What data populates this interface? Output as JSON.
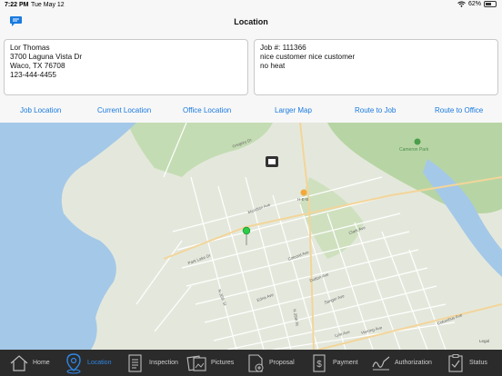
{
  "status": {
    "time": "7:22 PM",
    "date": "Tue May 12",
    "battery_text": "62%",
    "battery_level": 0.62
  },
  "nav": {
    "title": "Location"
  },
  "customer": {
    "lines": [
      "Lor Thomas",
      "3700 Laguna Vista Dr",
      "Waco, TX  76708",
      "123-444-4455"
    ]
  },
  "job": {
    "lines": [
      "Job #: 111366",
      "nice customer nice customer",
      "no heat"
    ]
  },
  "actions": [
    "Job Location",
    "Current Location",
    "Office Location",
    "Larger Map",
    "Route to Job",
    "Route to Office"
  ],
  "map": {
    "labels": {
      "park_lake": "Park Lake Dr",
      "cameron_park": "Cameron Park",
      "heb": "H-E-B",
      "legal": "Legal",
      "meridian": "Meridian Ave",
      "gregory": "Gregory Dr",
      "n_36th": "N 36th St",
      "n_29th": "N 29th St",
      "lyle": "Lyle Ave",
      "herring": "Herring Ave",
      "clark": "Clark Ave",
      "edna": "Edna Ave",
      "sanger": "Sanger Ave",
      "dutton": "Dutton Ave",
      "colcord": "Colcord Ave",
      "columbus": "Columbus Ave"
    }
  },
  "tabs": [
    {
      "label": "Home",
      "icon": "home-icon"
    },
    {
      "label": "Location",
      "icon": "location-pin-icon"
    },
    {
      "label": "Inspection",
      "icon": "inspection-document-icon"
    },
    {
      "label": "Pictures",
      "icon": "pictures-icon"
    },
    {
      "label": "Proposal",
      "icon": "proposal-icon"
    },
    {
      "label": "Payment",
      "icon": "payment-icon"
    },
    {
      "label": "Authorization",
      "icon": "signature-icon"
    },
    {
      "label": "Status",
      "icon": "status-checklist-icon"
    }
  ],
  "colors": {
    "accent": "#1a7ae0",
    "tabbar": "#2b2b2b",
    "water": "#a4c8e8",
    "park": "#b7d5a4",
    "pin": "#2ecc4a"
  }
}
